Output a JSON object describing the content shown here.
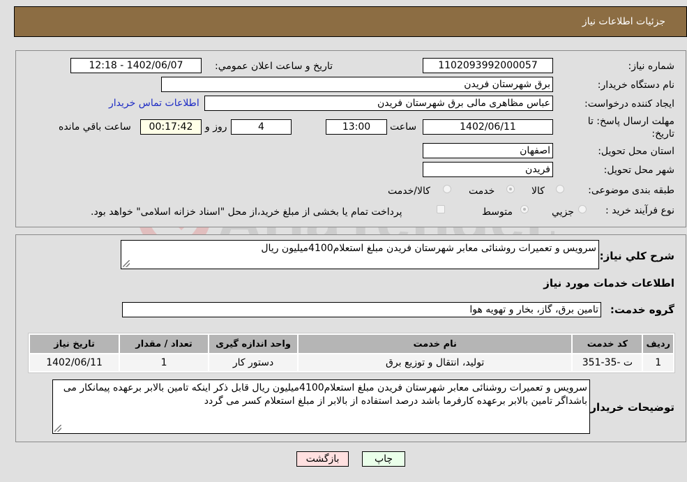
{
  "header": {
    "title": "جزئيات اطلاعات نياز"
  },
  "details": {
    "need_number_label": "شماره نياز:",
    "need_number": "1102093992000057",
    "announce_label": "تاريخ و ساعت اعلان عمومي:",
    "announce_value": "1402/06/07 - 12:18",
    "buyer_org_label": "نام دستگاه خريدار:",
    "buyer_org": "برق شهرستان فريدن",
    "creator_label": "ايجاد کننده درخواست:",
    "creator": "عباس مظاهری مالی برق شهرستان فريدن",
    "contact_link": "اطلاعات تماس خريدار",
    "deadline_label": "مهلت ارسال پاسخ: تا تاريخ:",
    "deadline_date": "1402/06/11",
    "time_label": "ساعت",
    "deadline_time": "13:00",
    "days_value": "4",
    "days_label": "روز و",
    "remaining_value": "00:17:42",
    "remaining_label": "ساعت باقي مانده",
    "province_label": "استان محل تحويل:",
    "province": "اصفهان",
    "city_label": "شهر محل تحويل:",
    "city": "فريدن",
    "category_label": "طبقه بندی موضوعی:",
    "category_options": [
      {
        "label": "کالا",
        "checked": false
      },
      {
        "label": "خدمت",
        "checked": true
      },
      {
        "label": "کالا/خدمت",
        "checked": false
      }
    ],
    "process_label": "نوع فرآيند خريد :",
    "process_options": [
      {
        "label": "جزيي",
        "checked": false
      },
      {
        "label": "متوسط",
        "checked": true
      }
    ],
    "treasury_note": "پرداخت تمام يا بخشی از مبلغ خريد،از محل \"اسناد خزانه اسلامی\" خواهد بود."
  },
  "summary": {
    "description_label": "شرح کلي نياز:",
    "description": "سرويس و تعميرات روشنائی معابر شهرستان فريدن مبلغ استعلام4100ميليون ريال",
    "services_heading": "اطلاعات خدمات مورد نياز",
    "service_group_label": "گروه خدمت:",
    "service_group": "تامين برق، گاز، بخار و تهويه هوا",
    "table": {
      "columns": [
        "رديف",
        "کد خدمت",
        "نام خدمت",
        "واحد اندازه گيری",
        "تعداد / مقدار",
        "تاريخ نياز"
      ],
      "rows": [
        [
          "1",
          "ت -35-351",
          "توليد، انتقال و توزيع برق",
          "دستور کار",
          "1",
          "1402/06/11"
        ]
      ]
    },
    "buyer_notes_label": "توضيحات خريدار:",
    "buyer_notes": "سرويس و تعميرات روشنائی معابر شهرستان فريدن مبلغ استعلام4100ميليون ريال قابل ذکر اينکه تامين بالابر برعهده پيمانکار می باشداگر تامين بالابر برعهده کارفرما باشد درصد استفاده از بالابر از مبلغ استعلام کسر می گردد"
  },
  "buttons": {
    "print": "چاپ",
    "back": "بازگشت"
  },
  "watermark": {
    "text": "AriaTender.neT"
  },
  "colors": {
    "header": "#8c6d43",
    "print_bg": "#eaffea",
    "back_bg": "#ffe0e0",
    "remaining_bg": "#ffffe8",
    "link": "#1d2bc4"
  }
}
